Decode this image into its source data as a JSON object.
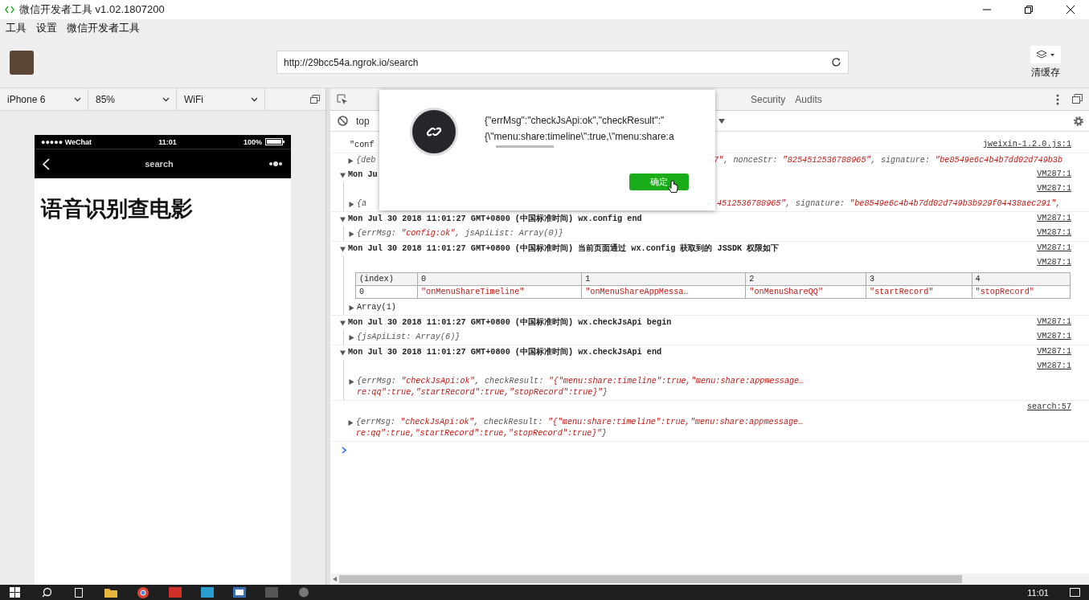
{
  "window": {
    "title": "微信开发者工具 v1.02.1807200"
  },
  "menu": [
    "工具",
    "设置",
    "微信开发者工具"
  ],
  "toolbar": {
    "url": "http://29bcc54a.ngrok.io/search",
    "clear_cache": "清缓存"
  },
  "device_bar": [
    "iPhone 6",
    "85%",
    "WiFi"
  ],
  "simulator": {
    "carrier": "●●●●● WeChat",
    "time": "11:01",
    "battery": "100%",
    "nav_title": "search",
    "heading": "语音识别查电影"
  },
  "devtools": {
    "tabs": [
      {
        "label": "Security",
        "selected": false
      },
      {
        "label": "Audits",
        "selected": false
      }
    ],
    "context": "top",
    "log": [
      {
        "kind": "text",
        "segments": [
          {
            "kind": "plain",
            "text": "\"conf"
          }
        ],
        "source": "jweixin-1.2.0.js:1"
      },
      {
        "kind": "object",
        "expanded": false,
        "segments": [
          {
            "kind": "key",
            "text": "{deb"
          }
        ],
        "tail": [
          {
            "kind": "string",
            "text": "7\""
          },
          {
            "kind": "key",
            "text": ", nonceStr: "
          },
          {
            "kind": "string",
            "text": "\"8254512536788965\""
          },
          {
            "kind": "key",
            "text": ", signature: "
          },
          {
            "kind": "string",
            "text": "\"be8549e6c4b4b7dd02d749b3b"
          }
        ]
      },
      {
        "kind": "group",
        "expanded": true,
        "text": "Mon Ju",
        "children": [
          {
            "kind": "source",
            "source": "VM287:1"
          },
          {
            "kind": "object",
            "expanded": false,
            "segments": [
              {
                "kind": "key",
                "text": "{a"
              }
            ],
            "tail": [
              {
                "kind": "string",
                "text": "4512536788965\""
              },
              {
                "kind": "key",
                "text": ", signature: "
              },
              {
                "kind": "string",
                "text": "\"be8549e6c4b4b7dd02d749b3b929f04438aec291\""
              },
              {
                "kind": "key",
                "text": ","
              }
            ]
          }
        ],
        "source": "VM287:1"
      },
      {
        "kind": "group",
        "expanded": true,
        "text": "Mon Jul 30 2018 11:01:27 GMT+0800 (中国标准时间) wx.config end",
        "source": "VM287:1",
        "children": [
          {
            "kind": "object",
            "expanded": false,
            "segments": [
              {
                "kind": "key",
                "text": "{errMsg: "
              },
              {
                "kind": "string",
                "text": "\"config:ok\""
              },
              {
                "kind": "key",
                "text": ", jsApiList: Array(0)}"
              }
            ],
            "source": "VM287:1"
          }
        ]
      },
      {
        "kind": "group",
        "expanded": true,
        "text": "Mon Jul 30 2018 11:01:27 GMT+0800 (中国标准时间) 当前页面通过 wx.config 获取到的 JSSDK 权限如下",
        "source": "VM287:1",
        "children": [
          {
            "kind": "source",
            "source": "VM287:1"
          },
          {
            "kind": "table",
            "columns": [
              "(index)",
              "0",
              "1",
              "2",
              "3",
              "4"
            ],
            "rows": [
              [
                "0",
                "\"onMenuShareTimeline\"",
                "\"onMenuShareAppMessa…",
                "\"onMenuShareQQ\"",
                "\"startRecord\"",
                "\"stopRecord\""
              ]
            ]
          },
          {
            "kind": "array",
            "expanded": false,
            "segments": [
              {
                "kind": "plain",
                "text": "Array(1)"
              }
            ]
          }
        ]
      },
      {
        "kind": "group",
        "expanded": true,
        "text": "Mon Jul 30 2018 11:01:27 GMT+0800 (中国标准时间) wx.checkJsApi begin",
        "source": "VM287:1",
        "children": [
          {
            "kind": "object",
            "expanded": false,
            "segments": [
              {
                "kind": "key",
                "text": "{jsApiList: Array(6)}"
              }
            ],
            "source": "VM287:1"
          }
        ]
      },
      {
        "kind": "group",
        "expanded": true,
        "text": "Mon Jul 30 2018 11:01:27 GMT+0800 (中国标准时间) wx.checkJsApi end",
        "source": "VM287:1",
        "children": [
          {
            "kind": "source",
            "source": "VM287:1"
          },
          {
            "kind": "object",
            "expanded": false,
            "segments": [
              {
                "kind": "key",
                "text": "{errMsg: "
              },
              {
                "kind": "string",
                "text": "\"checkJsApi:ok\""
              },
              {
                "kind": "key",
                "text": ", checkResult: "
              },
              {
                "kind": "string",
                "text": "\"{\"menu:share:timeline\":true,\"menu:share:appmessage…"
              },
              {
                "kind": "break"
              },
              {
                "kind": "string",
                "text": "re:qq\":true,\"startRecord\":true,\"stopRecord\":true}\""
              },
              {
                "kind": "key",
                "text": "}"
              }
            ]
          }
        ]
      },
      {
        "kind": "source",
        "source": "search:57"
      },
      {
        "kind": "object",
        "expanded": false,
        "segments": [
          {
            "kind": "key",
            "text": "{errMsg: "
          },
          {
            "kind": "string",
            "text": "\"checkJsApi:ok\""
          },
          {
            "kind": "key",
            "text": ", checkResult: "
          },
          {
            "kind": "string",
            "text": "\"{\"menu:share:timeline\":true,\"menu:share:appmessage…"
          },
          {
            "kind": "break"
          },
          {
            "kind": "string",
            "text": "re:qq\":true,\"startRecord\":true,\"stopRecord\":true}\""
          },
          {
            "kind": "key",
            "text": "}"
          }
        ]
      }
    ]
  },
  "dialog": {
    "lines": [
      "{\"errMsg\":\"checkJsApi:ok\",\"checkResult\":\"",
      "{\\\"menu:share:timeline\\\":true,\\\"menu:share:a"
    ],
    "button": "确定"
  },
  "taskbar": {
    "time": "11:01"
  }
}
